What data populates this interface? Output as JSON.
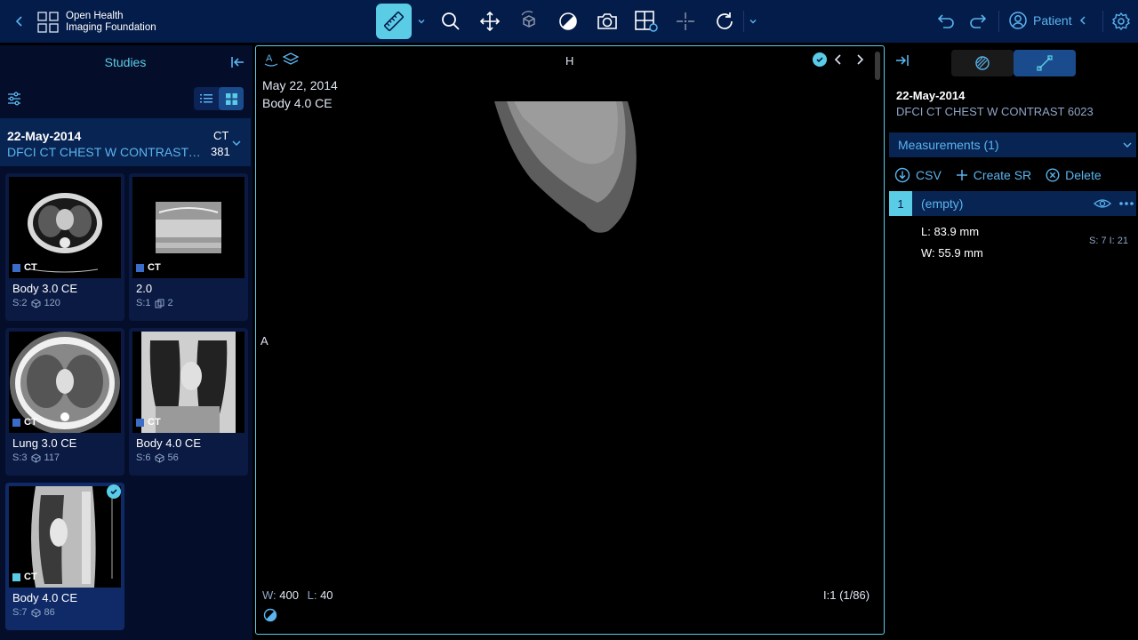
{
  "header": {
    "logo_line1": "Open Health",
    "logo_line2": "Imaging Foundation",
    "patient_label": "Patient",
    "colors": {
      "bar": "#041c4a",
      "accent": "#5acce6",
      "link": "#5ab4f0"
    },
    "tools": [
      "measure-icon",
      "zoom-icon",
      "pan-icon",
      "rotate-3d-icon",
      "window-level-icon",
      "capture-icon",
      "layout-icon",
      "crosshairs-icon",
      "reset-icon"
    ]
  },
  "studies_panel": {
    "title": "Studies",
    "study": {
      "date": "22-May-2014",
      "description": "DFCI CT CHEST W CONTRAST 6...",
      "modality": "CT",
      "count": "381"
    },
    "series": [
      {
        "name": "Body 3.0 CE",
        "s": "S:2",
        "count": "120",
        "modality": "CT"
      },
      {
        "name": "2.0",
        "s": "S:1",
        "count": "2",
        "modality": "CT"
      },
      {
        "name": "Lung 3.0 CE",
        "s": "S:3",
        "count": "117",
        "modality": "CT"
      },
      {
        "name": "Body 4.0 CE",
        "s": "S:6",
        "count": "56",
        "modality": "CT"
      },
      {
        "name": "Body 4.0 CE",
        "s": "S:7",
        "count": "86",
        "modality": "CT"
      }
    ]
  },
  "viewport": {
    "date": "May 22, 2014",
    "series": "Body 4.0 CE",
    "orientation_top": "H",
    "orientation_left": "A",
    "window_label": "W:",
    "window_value": "400",
    "level_label": "L:",
    "level_value": "40",
    "image_index": "I:1 (1/86)"
  },
  "measurements_panel": {
    "date": "22-May-2014",
    "description": "DFCI CT CHEST W CONTRAST 6023",
    "header": "Measurements (1)",
    "actions": {
      "csv": "CSV",
      "create_sr": "Create SR",
      "delete": "Delete"
    },
    "items": [
      {
        "number": "1",
        "label": "(empty)",
        "length": "L: 83.9 mm",
        "width": "W: 55.9 mm",
        "slice_info": "S: 7 I: 21"
      }
    ]
  }
}
